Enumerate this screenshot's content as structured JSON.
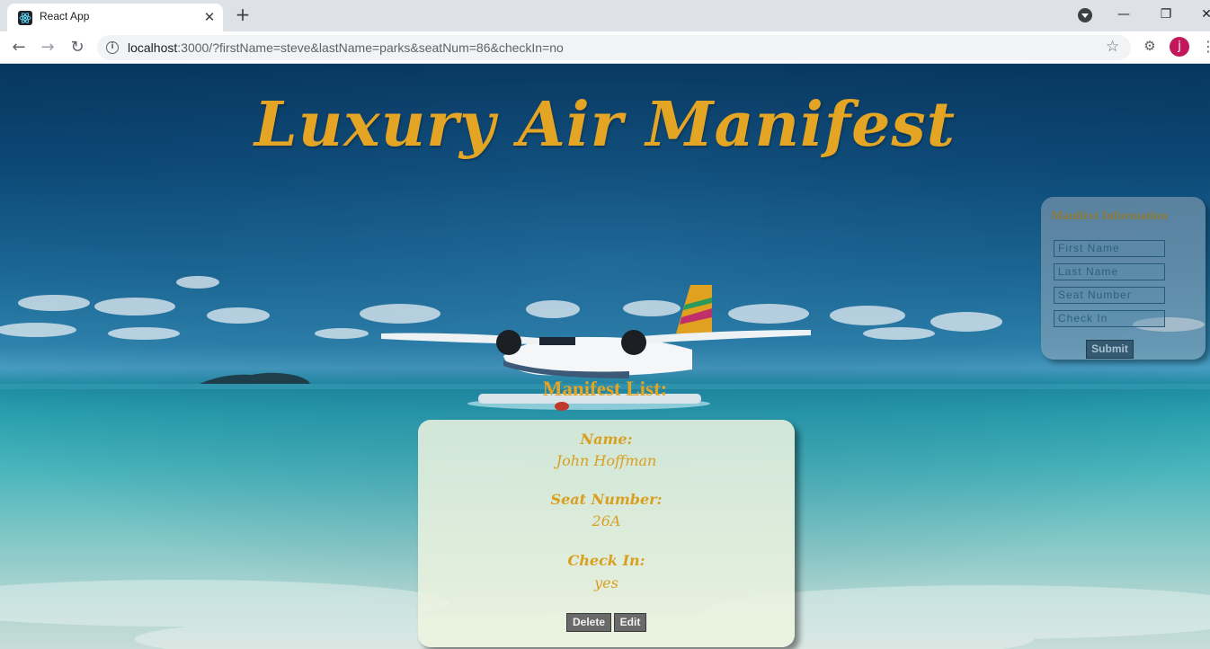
{
  "browser": {
    "tab_title": "React App",
    "tab_close": "✕",
    "new_tab": "+",
    "url_host": "localhost",
    "url_rest": ":3000/?firstName=steve&lastName=parks&seatNum=86&checkIn=no",
    "avatar_letter": "j"
  },
  "page": {
    "title": "Luxury Air Manifest",
    "list_heading": "Manifest List:"
  },
  "form": {
    "title": "Manifest Information",
    "first_name_placeholder": "First Name",
    "last_name_placeholder": "Last Name",
    "seat_number_placeholder": "Seat Number",
    "check_in_placeholder": "Check In",
    "submit_label": "Submit"
  },
  "passenger": {
    "name_label": "Name:",
    "name": "John Hoffman",
    "seat_label": "Seat Number:",
    "seat": "26A",
    "checkin_label": "Check In:",
    "checkin": "yes",
    "delete_label": "Delete",
    "edit_label": "Edit"
  }
}
